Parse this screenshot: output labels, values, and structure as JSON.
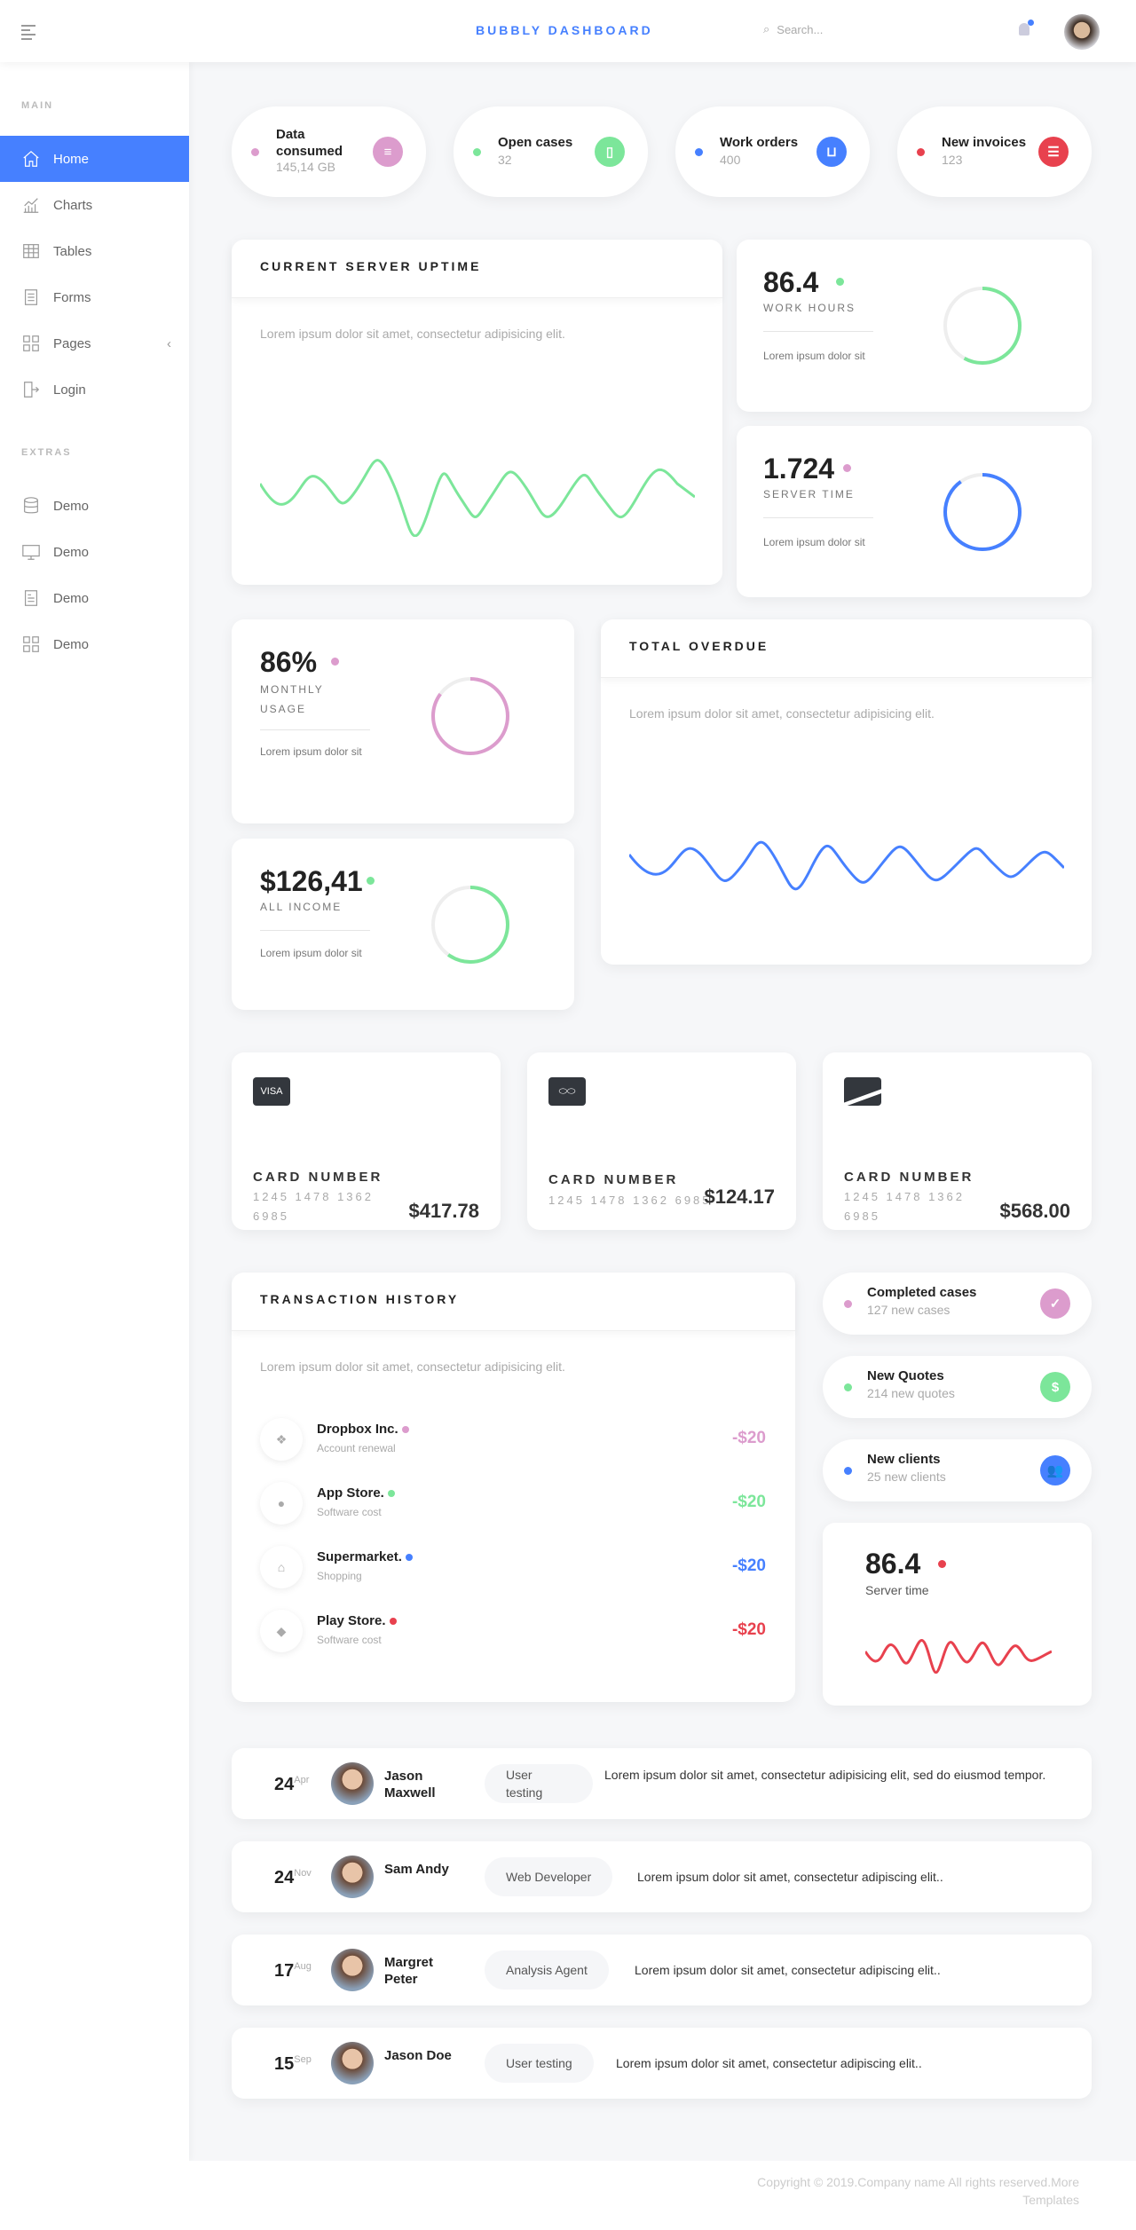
{
  "header": {
    "menu_icon": "hamburger-icon",
    "brand": "BUBBLY DASHBOARD",
    "search_placeholder": "Search...",
    "bell_icon": "bell-icon"
  },
  "sidebar": {
    "main_label": "MAIN",
    "items": [
      {
        "label": "Home",
        "icon": "home-icon",
        "active": true
      },
      {
        "label": "Charts",
        "icon": "chart-icon"
      },
      {
        "label": "Tables",
        "icon": "table-icon"
      },
      {
        "label": "Forms",
        "icon": "form-icon"
      },
      {
        "label": "Pages",
        "icon": "pages-icon"
      },
      {
        "label": "Login",
        "icon": "login-icon"
      }
    ],
    "extras_label": "EXTRAS",
    "extras": [
      {
        "label": "Demo",
        "icon": "database-icon"
      },
      {
        "label": "Demo",
        "icon": "monitor-icon"
      },
      {
        "label": "Demo",
        "icon": "document-icon"
      },
      {
        "label": "Demo",
        "icon": "grid-icon"
      }
    ]
  },
  "stats": [
    {
      "title": "Data consumed",
      "value": "145,14 GB",
      "color": "#dc9ccd",
      "icon": "server-icon"
    },
    {
      "title": "Open cases",
      "value": "32",
      "color": "#7ce69a",
      "icon": "clipboard-icon"
    },
    {
      "title": "Work orders",
      "value": "400",
      "color": "#4680ff",
      "icon": "cart-icon"
    },
    {
      "title": "New invoices",
      "value": "123",
      "color": "#e8414e",
      "icon": "invoice-icon"
    }
  ],
  "uptime": {
    "title": "CURRENT SERVER UPTIME",
    "text": "Lorem ipsum dolor sit amet, consectetur adipisicing elit.",
    "color": "#7ce69a"
  },
  "metrics": [
    {
      "value": "86.4",
      "label": "WORK HOURS",
      "text": "Lorem ipsum dolor sit",
      "color": "#7ce69a",
      "progress": 0.58
    },
    {
      "value": "1.724",
      "label": "SERVER TIME",
      "text": "Lorem ipsum dolor sit",
      "color": "#4680ff",
      "progress": 0.9,
      "dot": "#dc9ccd"
    },
    {
      "value": "86%",
      "label": "MONTHLY USAGE",
      "text": "Lorem ipsum dolor sit",
      "color": "#dc9ccd",
      "progress": 0.85
    },
    {
      "value": "$126,41",
      "label": "ALL INCOME",
      "text": "Lorem ipsum dolor sit",
      "color": "#7ce69a",
      "progress": 0.6
    }
  ],
  "overdue": {
    "title": "TOTAL OVERDUE",
    "text": "Lorem ipsum dolor sit amet, consectetur adipisicing elit.",
    "color": "#4680ff"
  },
  "cards": [
    {
      "brand": "VISA",
      "icon": "visa-icon",
      "label": "CARD NUMBER",
      "number": "1245 1478 1362 6985",
      "amount": "$417.78"
    },
    {
      "brand": "",
      "icon": "mastercard-icon",
      "label": "CARD NUMBER",
      "number": "1245 1478 1362 6985",
      "amount": "$124.17"
    },
    {
      "brand": "",
      "icon": "card-icon",
      "label": "CARD NUMBER",
      "number": "1245 1478 1362 6985",
      "amount": "$568.00"
    }
  ],
  "transactions": {
    "title": "TRANSACTION HISTORY",
    "text": "Lorem ipsum dolor sit amet, consectetur adipisicing elit.",
    "items": [
      {
        "name": "Dropbox Inc.",
        "desc": "Account renewal",
        "amount": "-$20",
        "color": "#dc9ccd",
        "icon": "dropbox-icon",
        "glyph": "❖"
      },
      {
        "name": "App Store.",
        "desc": "Software cost",
        "amount": "-$20",
        "color": "#7ce69a",
        "icon": "apple-icon",
        "glyph": "●"
      },
      {
        "name": "Supermarket.",
        "desc": "Shopping",
        "amount": "-$20",
        "color": "#4680ff",
        "icon": "basket-icon",
        "glyph": "⌂"
      },
      {
        "name": "Play Store.",
        "desc": "Software cost",
        "amount": "-$20",
        "color": "#e8414e",
        "icon": "android-icon",
        "glyph": "◆"
      }
    ]
  },
  "side_stats": [
    {
      "title": "Completed cases",
      "value": "127 new cases",
      "color": "#dc9ccd",
      "icon": "clipboard-check-icon",
      "glyph": "✓"
    },
    {
      "title": "New Quotes",
      "value": "214 new quotes",
      "color": "#7ce69a",
      "icon": "dollar-icon",
      "glyph": "$"
    },
    {
      "title": "New clients",
      "value": "25 new clients",
      "color": "#4680ff",
      "icon": "users-icon",
      "glyph": "👥"
    }
  ],
  "server": {
    "value": "86.4",
    "label": "Server time",
    "color": "#e8414e"
  },
  "activity": [
    {
      "day": "24",
      "month": "Apr",
      "name": "Jason Maxwell",
      "tag": "User testing",
      "text": "Lorem ipsum dolor sit amet, consectetur adipisicing elit, sed do eiusmod tempor."
    },
    {
      "day": "24",
      "month": "Nov",
      "name": "Sam Andy",
      "tag": "Web Developer",
      "text": "Lorem ipsum dolor sit amet, consectetur adipiscing elit.."
    },
    {
      "day": "17",
      "month": "Aug",
      "name": "Margret Peter",
      "tag": "Analysis Agent",
      "text": "Lorem ipsum dolor sit amet, consectetur adipiscing elit.."
    },
    {
      "day": "15",
      "month": "Sep",
      "name": "Jason Doe",
      "tag": "User testing",
      "text": "Lorem ipsum dolor sit amet, consectetur adipiscing elit.."
    }
  ],
  "footer": {
    "text": "Copyright © 2019.Company name All rights reserved.More Templates"
  }
}
